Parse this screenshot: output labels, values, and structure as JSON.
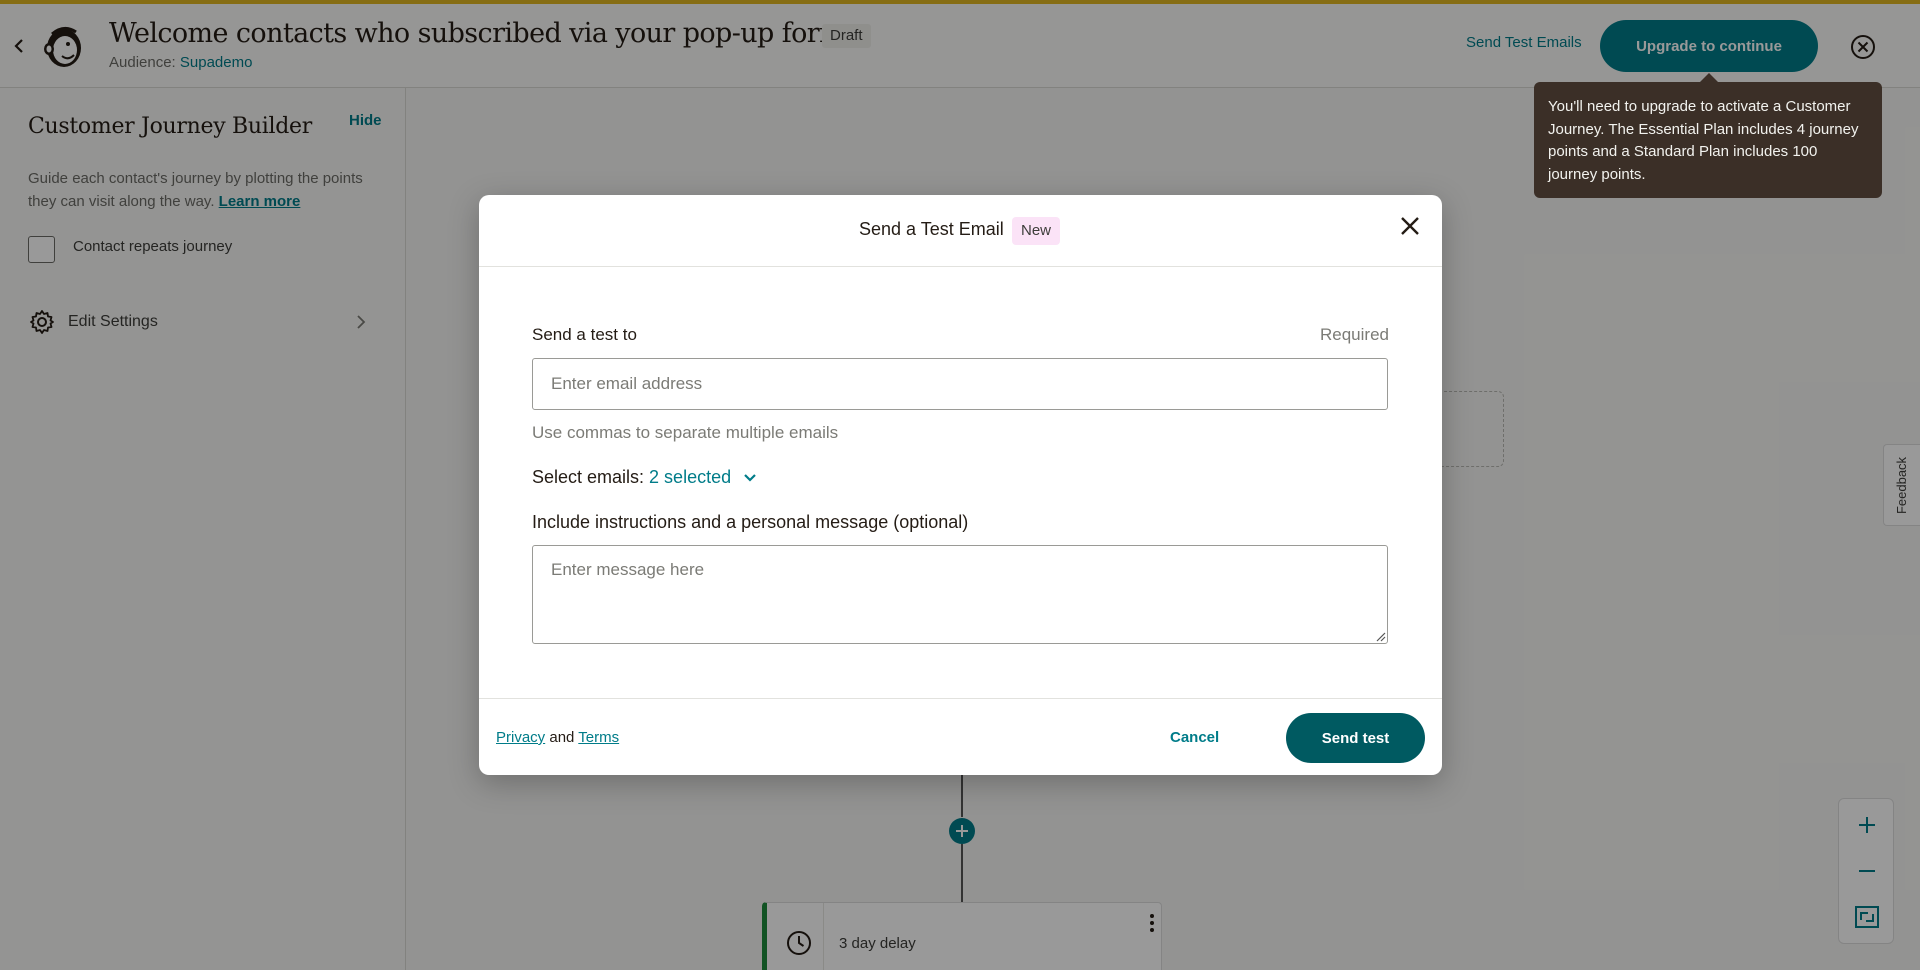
{
  "header": {
    "title": "Welcome contacts who subscribed via your pop-up form",
    "draft_badge": "Draft",
    "audience_label": "Audience:",
    "audience_name": "Supademo",
    "send_test_emails": "Send Test Emails",
    "upgrade_button": "Upgrade to continue"
  },
  "tooltip": {
    "text": "You'll need to upgrade to activate a Customer Journey. The Essential Plan includes 4 journey points and a Standard Plan includes 100 journey points."
  },
  "sidebar": {
    "title": "Customer Journey Builder",
    "hide": "Hide",
    "description": "Guide each contact's journey by plotting the points they can visit along the way.",
    "learn_more": "Learn more",
    "repeat_checkbox_label": "Contact repeats journey",
    "edit_settings": "Edit Settings"
  },
  "canvas": {
    "delay_card_label": "3 day delay",
    "feedback": "Feedback"
  },
  "modal": {
    "title": "Send a Test Email",
    "new_badge": "New",
    "send_to_label": "Send a test to",
    "required": "Required",
    "email_placeholder": "Enter email address",
    "email_value": "",
    "helper_text": "Use commas to separate multiple emails",
    "select_emails_label": "Select emails:",
    "select_emails_value": "2 selected",
    "message_label": "Include instructions and a personal message (optional)",
    "message_placeholder": "Enter message here",
    "privacy": "Privacy",
    "and": "and",
    "terms": "Terms",
    "cancel": "Cancel",
    "send_test": "Send test"
  },
  "colors": {
    "accent": "#007c89",
    "primary_button": "#005a61",
    "top_stripe": "#e0b622",
    "tooltip_bg": "#3b2f27",
    "new_badge_bg": "#fbe3f7",
    "delay_card_border": "#1d8a3b"
  },
  "icons": {
    "back": "chevron-left-icon",
    "logo": "mailchimp-logo-icon",
    "header_close": "close-circle-icon",
    "settings": "gear-icon",
    "settings_chevron": "chevron-right-icon",
    "modal_close": "close-icon",
    "select_chevron": "chevron-down-icon",
    "plus_node": "plus-icon",
    "delay": "clock-icon",
    "delay_menu": "vertical-dots-icon",
    "zoom_in": "plus-icon",
    "zoom_out": "minus-icon",
    "fit": "fit-screen-icon"
  }
}
